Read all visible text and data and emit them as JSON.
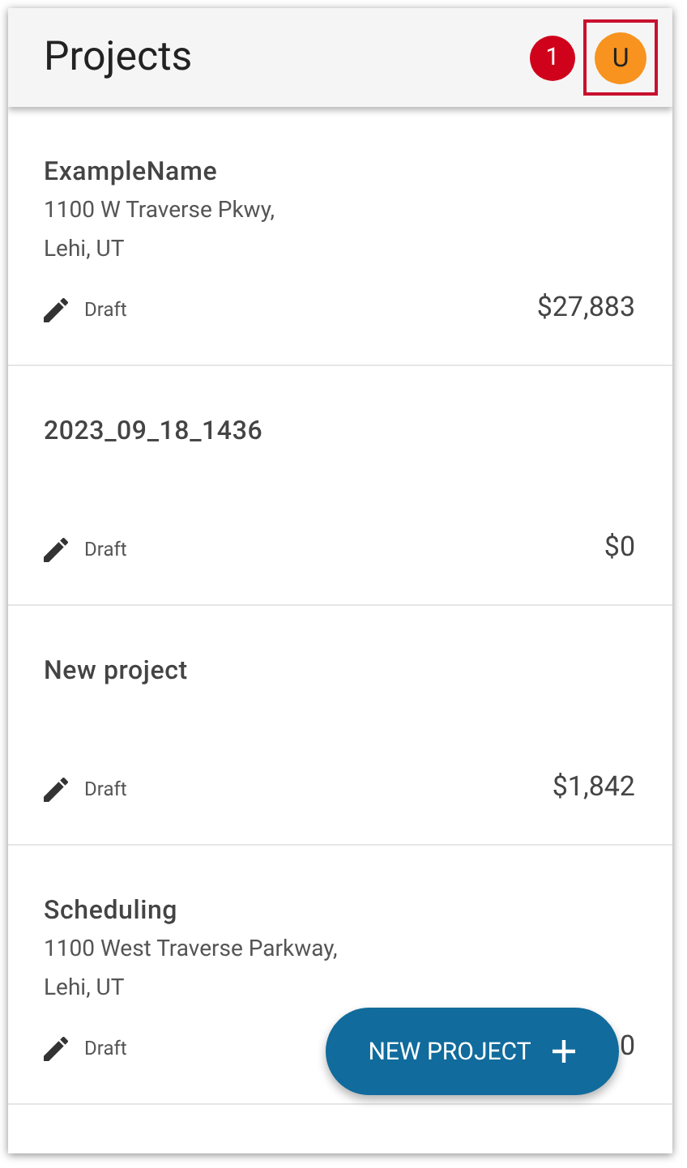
{
  "header": {
    "title": "Projects",
    "callout": {
      "number": "1"
    },
    "avatar": {
      "initial": "U"
    }
  },
  "projects": [
    {
      "name": "ExampleName",
      "address_lines": [
        "1100 W Traverse Pkwy,",
        "Lehi, UT"
      ],
      "status": "Draft",
      "amount": "$27,883"
    },
    {
      "name": "2023_09_18_1436",
      "status": "Draft",
      "amount": "$0"
    },
    {
      "name": "New project",
      "status": "Draft",
      "amount": "$1,842"
    },
    {
      "name": "Scheduling",
      "address_lines": [
        "1100 West Traverse Parkway,",
        "Lehi, UT"
      ],
      "status": "Draft",
      "amount": "0"
    }
  ],
  "fab": {
    "label": "NEW PROJECT"
  }
}
